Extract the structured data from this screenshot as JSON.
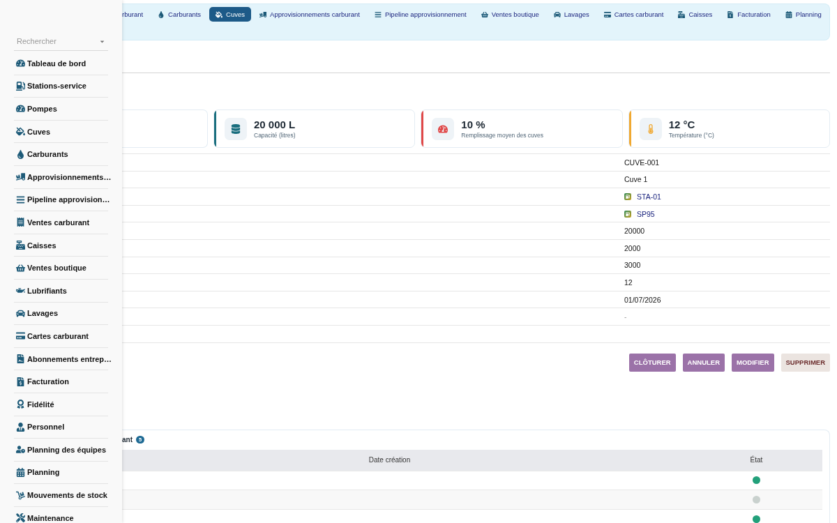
{
  "sidebar": {
    "search": {
      "placeholder": "Rechercher"
    },
    "items": [
      {
        "label": "Tableau de bord"
      },
      {
        "label": "Stations-service"
      },
      {
        "label": "Pompes"
      },
      {
        "label": "Cuves"
      },
      {
        "label": "Carburants"
      },
      {
        "label": "Approvisionnements…"
      },
      {
        "label": "Pipeline approvision…"
      },
      {
        "label": "Ventes carburant"
      },
      {
        "label": "Caisses"
      },
      {
        "label": "Ventes boutique"
      },
      {
        "label": "Lubrifiants"
      },
      {
        "label": "Lavages"
      },
      {
        "label": "Cartes carburant"
      },
      {
        "label": "Abonnements entrep…"
      },
      {
        "label": "Facturation"
      },
      {
        "label": "Fidélité"
      },
      {
        "label": "Personnel"
      },
      {
        "label": "Planning des équipes"
      },
      {
        "label": "Planning"
      },
      {
        "label": "Mouvements de stock"
      },
      {
        "label": "Maintenance"
      }
    ]
  },
  "nav": {
    "tabs": [
      {
        "label": "rburant",
        "selected": false
      },
      {
        "label": "Carburants",
        "selected": false
      },
      {
        "label": "Cuves",
        "selected": true
      },
      {
        "label": "Approvisionnements carburant",
        "selected": false
      },
      {
        "label": "Pipeline approvisionnement",
        "selected": false
      },
      {
        "label": "Ventes boutique",
        "selected": false
      },
      {
        "label": "Lavages",
        "selected": false
      },
      {
        "label": "Cartes carburant",
        "selected": false
      },
      {
        "label": "Caisses",
        "selected": false
      },
      {
        "label": "Facturation",
        "selected": false
      },
      {
        "label": "Planning",
        "selected": false
      }
    ]
  },
  "stats": [
    {
      "value": "20 000 L",
      "label": "Capacité (litres)",
      "color": "#1a6e7e"
    },
    {
      "value": "10 %",
      "label": "Remplissage moyen des cuves",
      "color": "#e04848"
    },
    {
      "value": "12 °C",
      "label": "Température (°C)",
      "color": "#f0a830"
    }
  ],
  "details": [
    {
      "kind": "text",
      "value": "CUVE-001"
    },
    {
      "kind": "text",
      "value": "Cuve 1"
    },
    {
      "kind": "link",
      "value": "STA-01"
    },
    {
      "kind": "link",
      "value": "SP95"
    },
    {
      "kind": "text",
      "value": "20000"
    },
    {
      "kind": "text",
      "value": "2000"
    },
    {
      "kind": "text",
      "value": "3000"
    },
    {
      "kind": "text",
      "value": "12"
    },
    {
      "kind": "text",
      "value": "01/07/2026"
    },
    {
      "kind": "muted",
      "value": "-"
    }
  ],
  "actions": [
    {
      "label": "CLÔTURER",
      "kind": "primary"
    },
    {
      "label": "ANNULER",
      "kind": "primary"
    },
    {
      "label": "MODIFIER",
      "kind": "primary"
    },
    {
      "label": "SUPPRIMER",
      "kind": "danger"
    }
  ],
  "list": {
    "title": "ant",
    "count": "5",
    "columns": [
      "Date création",
      "État"
    ],
    "rows": [
      {
        "color": "#22a07a"
      },
      {
        "color": "#c9d1ce"
      },
      {
        "color": "#22a07a"
      }
    ]
  }
}
